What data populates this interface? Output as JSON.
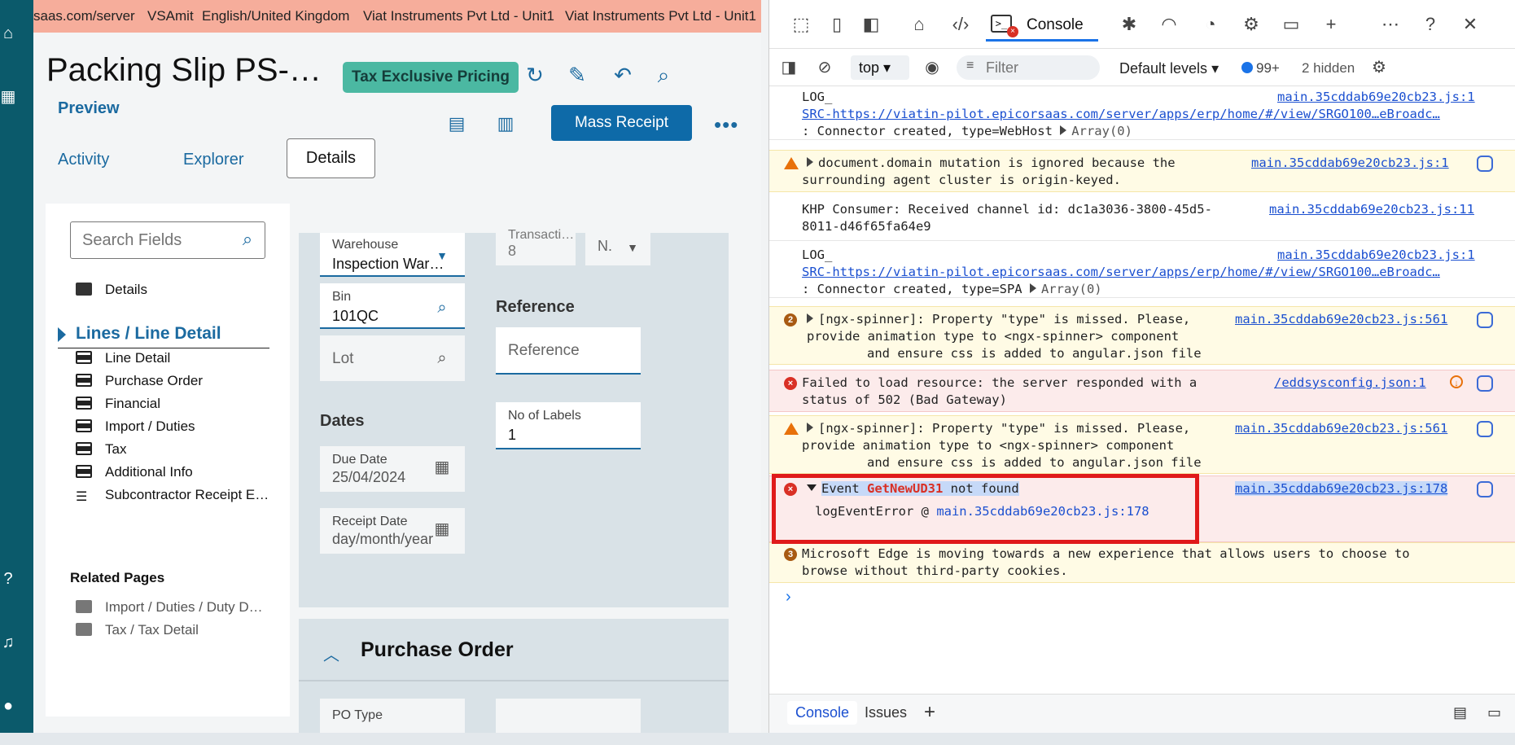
{
  "banner": {
    "segments": [
      "saas.com/server",
      "VSAmit",
      "English/United Kingdom",
      "Viat Instruments Pvt Ltd - Unit1",
      "Viat Instruments Pvt Ltd - Unit1"
    ]
  },
  "header": {
    "title": "Packing Slip PS-5…",
    "tax_badge": "Tax Exclusive Pricing",
    "preview": "Preview",
    "mass_receipt": "Mass Receipt",
    "more": "•••"
  },
  "tabs": {
    "activity": "Activity",
    "explorer": "Explorer",
    "details": "Details"
  },
  "search": {
    "placeholder": "Search Fields"
  },
  "tree": {
    "details": "Details",
    "lines_header": "Lines / Line Detail",
    "items": [
      "Line Detail",
      "Purchase Order",
      "Financial",
      "Import / Duties",
      "Tax",
      "Additional Info",
      "Subcontractor Receipt E…"
    ],
    "related_header": "Related Pages",
    "related": [
      "Import / Duties / Duty D…",
      "Tax / Tax Detail"
    ]
  },
  "form": {
    "warehouse_label": "Warehouse",
    "warehouse_value": "Inspection Wareh…",
    "transaction_label": "Transacti…",
    "transaction_value": "8",
    "n_value": "N.",
    "bin_label": "Bin",
    "bin_value": "101QC",
    "lot_placeholder": "Lot",
    "reference_section": "Reference",
    "reference_placeholder": "Reference",
    "labels_label": "No of Labels",
    "labels_value": "1",
    "dates_section": "Dates",
    "due_label": "Due Date",
    "due_value": "25/04/2024",
    "receipt_label": "Receipt Date",
    "receipt_value": "day/month/year",
    "po_section": "Purchase Order",
    "po_type_label": "PO Type"
  },
  "devtools": {
    "console_tab": "Console",
    "context": "top",
    "filter_placeholder": "Filter",
    "levels": "Default levels",
    "issues_count": "99+",
    "hidden": "2 hidden",
    "messages": {
      "m1_l1": "LOG_",
      "m1_l2": "SRC-https://viatin-pilot.epicorsaas.com/server/apps/erp/home/#/view/SRGO100…eBroadc…",
      "m1_l3": ": Connector created, type=WebHost",
      "m1_arr": "Array(0)",
      "m1_src": "main.35cddab69e20cb23.js:1",
      "m2_l1": "document.domain mutation is ignored because the",
      "m2_l2": "surrounding agent cluster is origin-keyed.",
      "m2_src": "main.35cddab69e20cb23.js:1",
      "m3_l1": "KHP Consumer: Received channel id: dc1a3036-3800-45d5-",
      "m3_l2": "8011-d46f65fa64e9",
      "m3_src": "main.35cddab69e20cb23.js:11",
      "m4_l1": "LOG_",
      "m4_l2": "SRC-https://viatin-pilot.epicorsaas.com/server/apps/erp/home/#/view/SRGO100…eBroadc…",
      "m4_l3": ": Connector created, type=SPA",
      "m4_arr": "Array(0)",
      "m4_src": "main.35cddab69e20cb23.js:1",
      "m5_count": "2",
      "m5_l1": "[ngx-spinner]: Property \"type\" is missed. Please,",
      "m5_l2": "provide animation type to <ngx-spinner> component",
      "m5_l3": "and ensure css is added to angular.json file",
      "m5_src": "main.35cddab69e20cb23.js:561",
      "m6_l1": "Failed to load resource: the server responded with a",
      "m6_l2": "status of 502 (Bad Gateway)",
      "m6_src": "/eddsysconfig.json:1",
      "m7_l1": "[ngx-spinner]: Property \"type\" is missed. Please,",
      "m7_l2": "provide animation type to <ngx-spinner> component",
      "m7_l3": "and ensure css is added to angular.json file",
      "m7_src": "main.35cddab69e20cb23.js:561",
      "m8_a": "Event ",
      "m8_b": "GetNewUD31",
      "m8_c": " not found",
      "m8_src": "main.35cddab69e20cb23.js:178",
      "m8_stack": "logEventError @ ",
      "m8_stack_src": "main.35cddab69e20cb23.js:178",
      "m9_count": "3",
      "m9_l1": "Microsoft Edge is moving towards a new experience that allows users to choose to",
      "m9_l2": "browse without third-party cookies."
    },
    "drawer_console": "Console",
    "drawer_issues": "Issues"
  },
  "colors": {
    "accent": "#1b6aa0",
    "nav": "#0b5a6b",
    "banner": "#f6ad9b",
    "badge": "#4bb8a2",
    "error_box": "#e01a1a"
  }
}
